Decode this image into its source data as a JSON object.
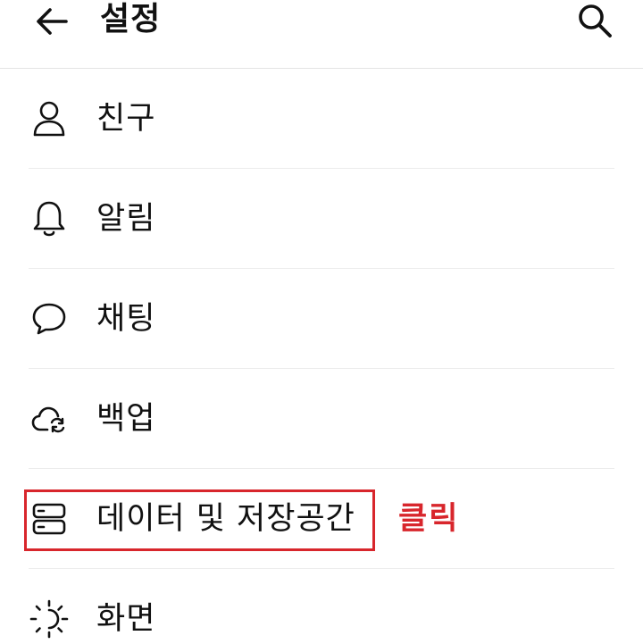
{
  "header": {
    "title": "설정",
    "back_icon": "arrow-left-icon",
    "search_icon": "search-icon"
  },
  "menu": {
    "items": [
      {
        "label": "친구",
        "icon": "person-icon"
      },
      {
        "label": "알림",
        "icon": "bell-icon"
      },
      {
        "label": "채팅",
        "icon": "chat-bubble-icon"
      },
      {
        "label": "백업",
        "icon": "cloud-sync-icon"
      },
      {
        "label": "데이터 및 저장공간",
        "icon": "storage-icon"
      },
      {
        "label": "화면",
        "icon": "sun-icon"
      }
    ]
  },
  "annotation": {
    "text": "클릭",
    "color": "#d8262c"
  }
}
